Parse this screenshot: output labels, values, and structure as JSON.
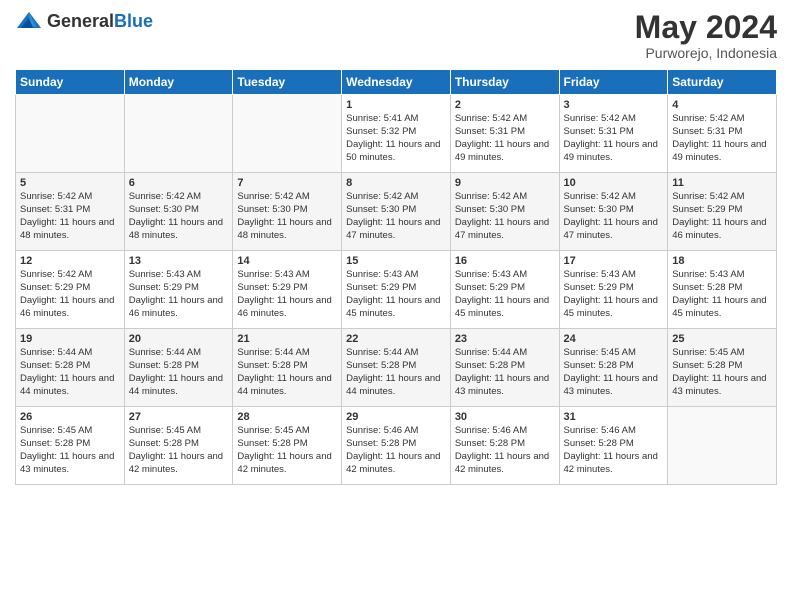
{
  "header": {
    "logo_general": "General",
    "logo_blue": "Blue",
    "title": "May 2024",
    "subtitle": "Purworejo, Indonesia"
  },
  "days_of_week": [
    "Sunday",
    "Monday",
    "Tuesday",
    "Wednesday",
    "Thursday",
    "Friday",
    "Saturday"
  ],
  "weeks": [
    [
      {
        "day": "",
        "info": ""
      },
      {
        "day": "",
        "info": ""
      },
      {
        "day": "",
        "info": ""
      },
      {
        "day": "1",
        "info": "Sunrise: 5:41 AM\nSunset: 5:32 PM\nDaylight: 11 hours and 50 minutes."
      },
      {
        "day": "2",
        "info": "Sunrise: 5:42 AM\nSunset: 5:31 PM\nDaylight: 11 hours and 49 minutes."
      },
      {
        "day": "3",
        "info": "Sunrise: 5:42 AM\nSunset: 5:31 PM\nDaylight: 11 hours and 49 minutes."
      },
      {
        "day": "4",
        "info": "Sunrise: 5:42 AM\nSunset: 5:31 PM\nDaylight: 11 hours and 49 minutes."
      }
    ],
    [
      {
        "day": "5",
        "info": "Sunrise: 5:42 AM\nSunset: 5:31 PM\nDaylight: 11 hours and 48 minutes."
      },
      {
        "day": "6",
        "info": "Sunrise: 5:42 AM\nSunset: 5:30 PM\nDaylight: 11 hours and 48 minutes."
      },
      {
        "day": "7",
        "info": "Sunrise: 5:42 AM\nSunset: 5:30 PM\nDaylight: 11 hours and 48 minutes."
      },
      {
        "day": "8",
        "info": "Sunrise: 5:42 AM\nSunset: 5:30 PM\nDaylight: 11 hours and 47 minutes."
      },
      {
        "day": "9",
        "info": "Sunrise: 5:42 AM\nSunset: 5:30 PM\nDaylight: 11 hours and 47 minutes."
      },
      {
        "day": "10",
        "info": "Sunrise: 5:42 AM\nSunset: 5:30 PM\nDaylight: 11 hours and 47 minutes."
      },
      {
        "day": "11",
        "info": "Sunrise: 5:42 AM\nSunset: 5:29 PM\nDaylight: 11 hours and 46 minutes."
      }
    ],
    [
      {
        "day": "12",
        "info": "Sunrise: 5:42 AM\nSunset: 5:29 PM\nDaylight: 11 hours and 46 minutes."
      },
      {
        "day": "13",
        "info": "Sunrise: 5:43 AM\nSunset: 5:29 PM\nDaylight: 11 hours and 46 minutes."
      },
      {
        "day": "14",
        "info": "Sunrise: 5:43 AM\nSunset: 5:29 PM\nDaylight: 11 hours and 46 minutes."
      },
      {
        "day": "15",
        "info": "Sunrise: 5:43 AM\nSunset: 5:29 PM\nDaylight: 11 hours and 45 minutes."
      },
      {
        "day": "16",
        "info": "Sunrise: 5:43 AM\nSunset: 5:29 PM\nDaylight: 11 hours and 45 minutes."
      },
      {
        "day": "17",
        "info": "Sunrise: 5:43 AM\nSunset: 5:29 PM\nDaylight: 11 hours and 45 minutes."
      },
      {
        "day": "18",
        "info": "Sunrise: 5:43 AM\nSunset: 5:28 PM\nDaylight: 11 hours and 45 minutes."
      }
    ],
    [
      {
        "day": "19",
        "info": "Sunrise: 5:44 AM\nSunset: 5:28 PM\nDaylight: 11 hours and 44 minutes."
      },
      {
        "day": "20",
        "info": "Sunrise: 5:44 AM\nSunset: 5:28 PM\nDaylight: 11 hours and 44 minutes."
      },
      {
        "day": "21",
        "info": "Sunrise: 5:44 AM\nSunset: 5:28 PM\nDaylight: 11 hours and 44 minutes."
      },
      {
        "day": "22",
        "info": "Sunrise: 5:44 AM\nSunset: 5:28 PM\nDaylight: 11 hours and 44 minutes."
      },
      {
        "day": "23",
        "info": "Sunrise: 5:44 AM\nSunset: 5:28 PM\nDaylight: 11 hours and 43 minutes."
      },
      {
        "day": "24",
        "info": "Sunrise: 5:45 AM\nSunset: 5:28 PM\nDaylight: 11 hours and 43 minutes."
      },
      {
        "day": "25",
        "info": "Sunrise: 5:45 AM\nSunset: 5:28 PM\nDaylight: 11 hours and 43 minutes."
      }
    ],
    [
      {
        "day": "26",
        "info": "Sunrise: 5:45 AM\nSunset: 5:28 PM\nDaylight: 11 hours and 43 minutes."
      },
      {
        "day": "27",
        "info": "Sunrise: 5:45 AM\nSunset: 5:28 PM\nDaylight: 11 hours and 42 minutes."
      },
      {
        "day": "28",
        "info": "Sunrise: 5:45 AM\nSunset: 5:28 PM\nDaylight: 11 hours and 42 minutes."
      },
      {
        "day": "29",
        "info": "Sunrise: 5:46 AM\nSunset: 5:28 PM\nDaylight: 11 hours and 42 minutes."
      },
      {
        "day": "30",
        "info": "Sunrise: 5:46 AM\nSunset: 5:28 PM\nDaylight: 11 hours and 42 minutes."
      },
      {
        "day": "31",
        "info": "Sunrise: 5:46 AM\nSunset: 5:28 PM\nDaylight: 11 hours and 42 minutes."
      },
      {
        "day": "",
        "info": ""
      }
    ]
  ]
}
